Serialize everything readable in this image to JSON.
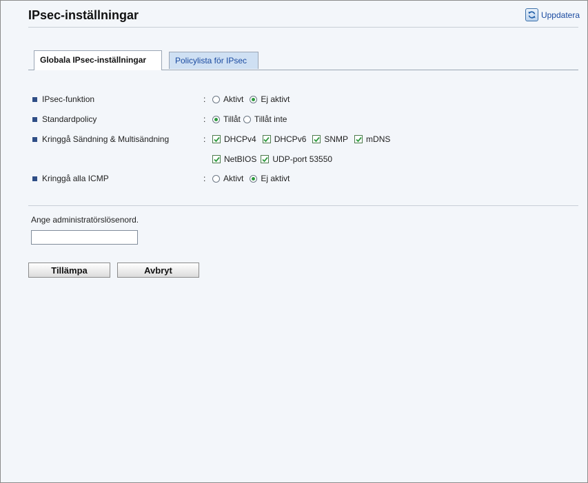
{
  "header": {
    "title": "IPsec-inställningar",
    "refresh_label": "Uppdatera"
  },
  "tabs": [
    {
      "label": "Globala IPsec-inställningar",
      "active": true
    },
    {
      "label": "Policylista för IPsec",
      "active": false
    }
  ],
  "settings": {
    "colon": ":",
    "ipsec_function": {
      "label": "IPsec-funktion",
      "options": [
        "Aktivt",
        "Ej aktivt"
      ],
      "selected": "Ej aktivt"
    },
    "default_policy": {
      "label": "Standardpolicy",
      "options": [
        "Tillåt",
        "Tillåt inte"
      ],
      "selected": "Tillåt"
    },
    "bypass_broadcast": {
      "label": "Kringgå Sändning & Multisändning",
      "checkboxes": [
        {
          "label": "DHCPv4",
          "checked": true
        },
        {
          "label": "DHCPv6",
          "checked": true
        },
        {
          "label": "SNMP",
          "checked": true
        },
        {
          "label": "mDNS",
          "checked": true
        },
        {
          "label": "NetBIOS",
          "checked": true
        },
        {
          "label": "UDP-port 53550",
          "checked": true
        }
      ]
    },
    "bypass_icmp": {
      "label": "Kringgå alla ICMP",
      "options": [
        "Aktivt",
        "Ej aktivt"
      ],
      "selected": "Ej aktivt"
    }
  },
  "password": {
    "prompt": "Ange administratörslösenord.",
    "value": ""
  },
  "buttons": {
    "apply": "Tillämpa",
    "cancel": "Avbryt"
  },
  "colors": {
    "accent": "#2f4e86",
    "link": "#1a4aa0",
    "check": "#2d9a3e"
  }
}
